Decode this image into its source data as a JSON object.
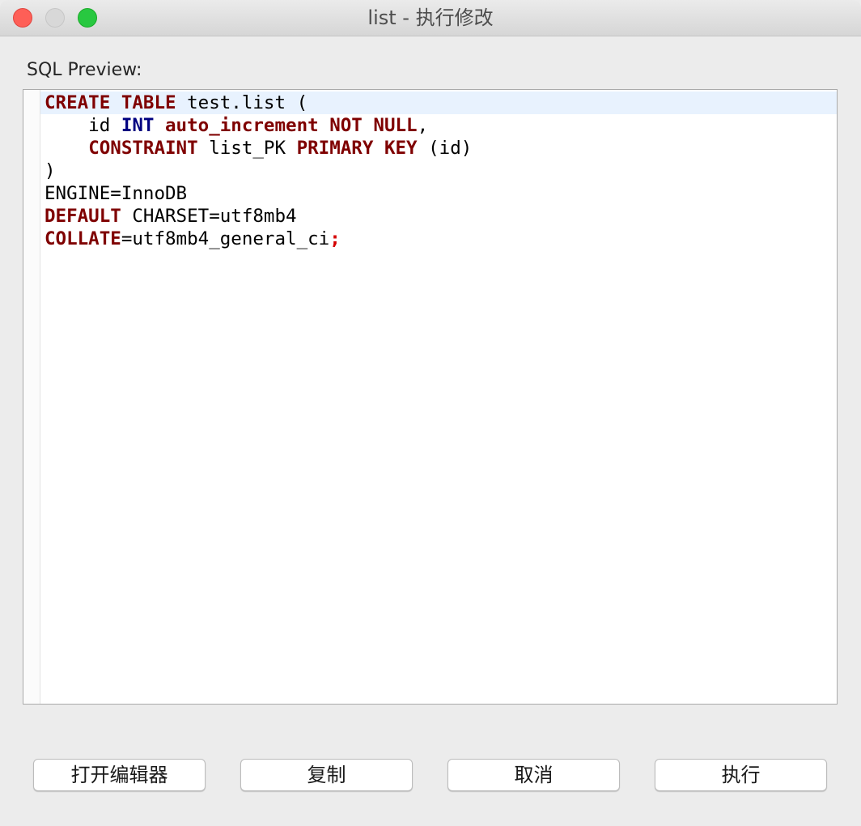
{
  "window": {
    "title": "list - 执行修改"
  },
  "preview": {
    "label": "SQL Preview:",
    "lines": [
      [
        {
          "t": "CREATE",
          "k": "kw"
        },
        {
          "t": " "
        },
        {
          "t": "TABLE",
          "k": "kw"
        },
        {
          "t": " test.list ("
        }
      ],
      [
        {
          "t": "    id "
        },
        {
          "t": "INT",
          "k": "ty"
        },
        {
          "t": " "
        },
        {
          "t": "auto_increment",
          "k": "kw"
        },
        {
          "t": " "
        },
        {
          "t": "NOT",
          "k": "kw"
        },
        {
          "t": " "
        },
        {
          "t": "NULL",
          "k": "kw"
        },
        {
          "t": ","
        }
      ],
      [
        {
          "t": "    "
        },
        {
          "t": "CONSTRAINT",
          "k": "kw"
        },
        {
          "t": " list_PK "
        },
        {
          "t": "PRIMARY",
          "k": "kw"
        },
        {
          "t": " "
        },
        {
          "t": "KEY",
          "k": "kw"
        },
        {
          "t": " (id)"
        }
      ],
      [
        {
          "t": ")"
        }
      ],
      [
        {
          "t": "ENGINE=InnoDB"
        }
      ],
      [
        {
          "t": "DEFAULT",
          "k": "kw"
        },
        {
          "t": " CHARSET=utf8mb4"
        }
      ],
      [
        {
          "t": "COLLATE",
          "k": "kw"
        },
        {
          "t": "=utf8mb4_general_ci"
        },
        {
          "t": ";",
          "k": "semi"
        }
      ]
    ]
  },
  "buttons": {
    "open_editor": "打开编辑器",
    "copy": "复制",
    "cancel": "取消",
    "execute": "执行"
  },
  "colors": {
    "keyword": "#7f0000",
    "type": "#000080",
    "semicolon": "#d40000",
    "close": "#fe5f57",
    "minimize": "#d8d8d8",
    "maximize": "#28c840"
  }
}
